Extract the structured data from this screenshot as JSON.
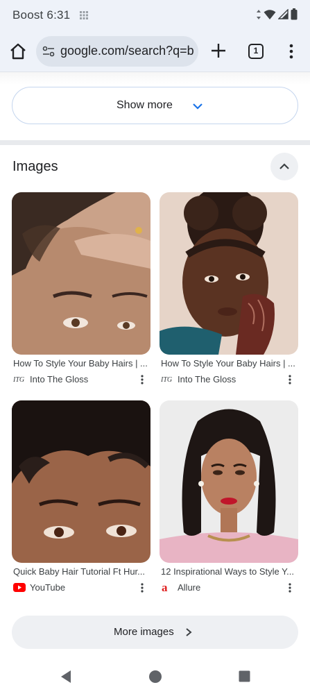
{
  "status_bar": {
    "carrier": "Boost",
    "time": "6:31"
  },
  "toolbar": {
    "url": "google.com/search?q=b",
    "tab_count": "1",
    "icons": [
      "home-icon",
      "site-settings-icon",
      "plus-icon",
      "tab-switcher-icon",
      "more-vert-icon"
    ]
  },
  "search": {
    "show_more_label": "Show more",
    "images_header": "Images",
    "more_images_label": "More images"
  },
  "images": [
    {
      "title": "How To Style Your Baby Hairs | ...",
      "source": "Into The Gloss",
      "source_logo": "ITG"
    },
    {
      "title": "How To Style Your Baby Hairs | ...",
      "source": "Into The Gloss",
      "source_logo": "ITG"
    },
    {
      "title": "Quick Baby Hair Tutorial Ft Hur...",
      "source": "YouTube",
      "source_logo": "youtube-icon"
    },
    {
      "title": "12 Inspirational Ways to Style Y...",
      "source": "Allure",
      "source_logo": "a"
    }
  ],
  "colors": {
    "chrome_bg": "#eef2f9",
    "accent_blue": "#1a73e8",
    "youtube_red": "#ff0000",
    "allure_red": "#e02020"
  }
}
